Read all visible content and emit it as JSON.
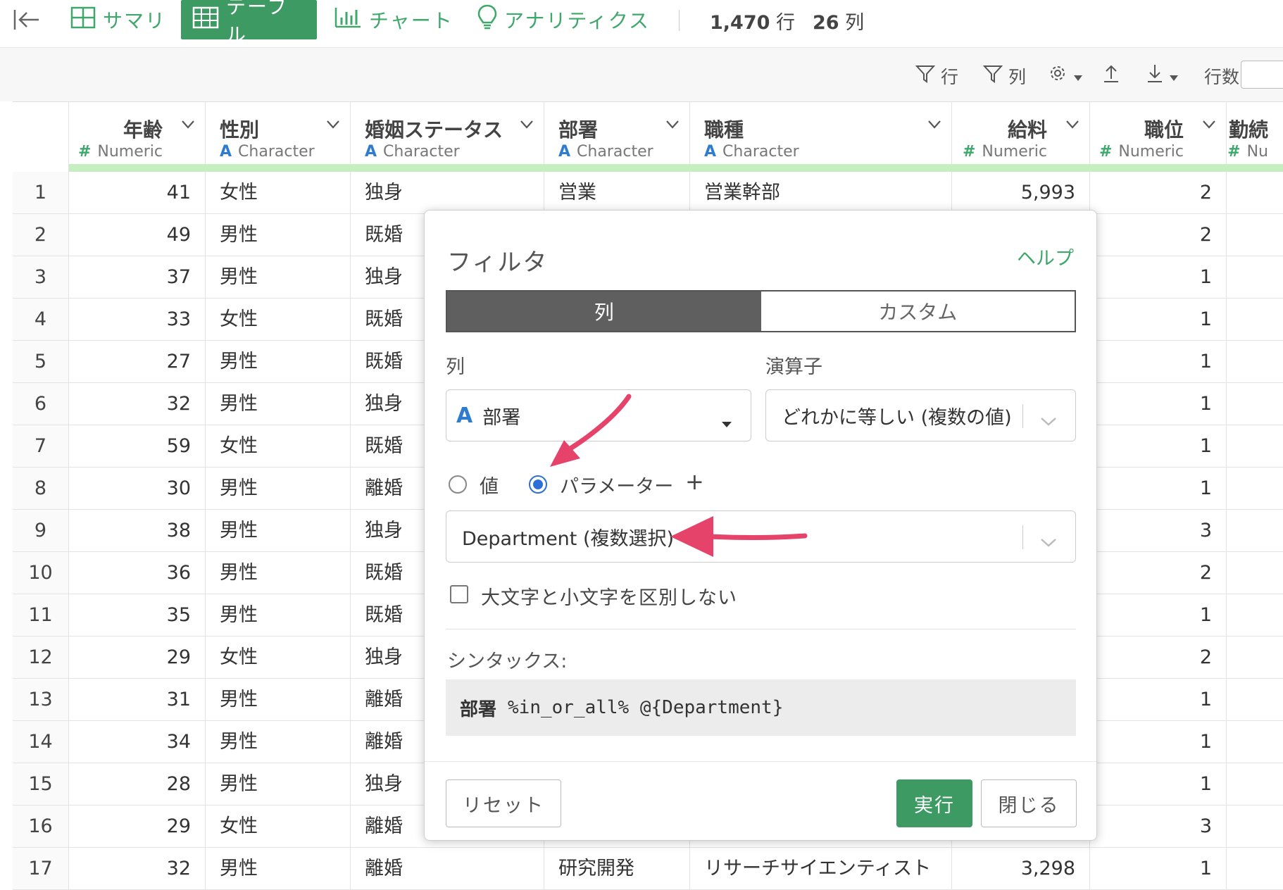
{
  "header": {
    "tabs": [
      {
        "label": "サマリ",
        "icon": "table-outline-icon"
      },
      {
        "label": "テーブル",
        "icon": "table-icon",
        "active": true
      },
      {
        "label": "チャート",
        "icon": "bar-chart-icon"
      },
      {
        "label": "アナリティクス",
        "icon": "lightbulb-icon"
      }
    ],
    "rows_count": "1,470",
    "rows_unit": "行",
    "cols_count": "26",
    "cols_unit": "列"
  },
  "toolbar": {
    "filter_rows": "行",
    "filter_cols": "列",
    "rows_per_page_label": "行数"
  },
  "columns": [
    {
      "name": "年齢",
      "type": "Numeric",
      "type_mark": "#"
    },
    {
      "name": "性別",
      "type": "Character",
      "type_mark": "A"
    },
    {
      "name": "婚姻ステータス",
      "type": "Character",
      "type_mark": "A"
    },
    {
      "name": "部署",
      "type": "Character",
      "type_mark": "A"
    },
    {
      "name": "職種",
      "type": "Character",
      "type_mark": "A"
    },
    {
      "name": "給料",
      "type": "Numeric",
      "type_mark": "#"
    },
    {
      "name": "職位",
      "type": "Numeric",
      "type_mark": "#"
    },
    {
      "name": "勤続",
      "type": "Nu",
      "type_mark": "#"
    }
  ],
  "rows": [
    {
      "n": "1",
      "age": "41",
      "sex": "女性",
      "mar": "独身",
      "dept": "営業",
      "job": "営業幹部",
      "sal": "5,993",
      "lvl": "2"
    },
    {
      "n": "2",
      "age": "49",
      "sex": "男性",
      "mar": "既婚",
      "dept": "",
      "job": "",
      "sal": "",
      "lvl": "2"
    },
    {
      "n": "3",
      "age": "37",
      "sex": "男性",
      "mar": "独身",
      "dept": "",
      "job": "",
      "sal": "",
      "lvl": "1"
    },
    {
      "n": "4",
      "age": "33",
      "sex": "女性",
      "mar": "既婚",
      "dept": "",
      "job": "",
      "sal": "",
      "lvl": "1"
    },
    {
      "n": "5",
      "age": "27",
      "sex": "男性",
      "mar": "既婚",
      "dept": "",
      "job": "",
      "sal": "",
      "lvl": "1"
    },
    {
      "n": "6",
      "age": "32",
      "sex": "男性",
      "mar": "独身",
      "dept": "",
      "job": "",
      "sal": "",
      "lvl": "1"
    },
    {
      "n": "7",
      "age": "59",
      "sex": "女性",
      "mar": "既婚",
      "dept": "",
      "job": "",
      "sal": "",
      "lvl": "1"
    },
    {
      "n": "8",
      "age": "30",
      "sex": "男性",
      "mar": "離婚",
      "dept": "",
      "job": "",
      "sal": "",
      "lvl": "1"
    },
    {
      "n": "9",
      "age": "38",
      "sex": "男性",
      "mar": "独身",
      "dept": "",
      "job": "",
      "sal": "",
      "lvl": "3"
    },
    {
      "n": "10",
      "age": "36",
      "sex": "男性",
      "mar": "既婚",
      "dept": "",
      "job": "",
      "sal": "",
      "lvl": "2"
    },
    {
      "n": "11",
      "age": "35",
      "sex": "男性",
      "mar": "既婚",
      "dept": "",
      "job": "",
      "sal": "",
      "lvl": "1"
    },
    {
      "n": "12",
      "age": "29",
      "sex": "女性",
      "mar": "独身",
      "dept": "",
      "job": "",
      "sal": "",
      "lvl": "2"
    },
    {
      "n": "13",
      "age": "31",
      "sex": "男性",
      "mar": "離婚",
      "dept": "",
      "job": "",
      "sal": "",
      "lvl": "1"
    },
    {
      "n": "14",
      "age": "34",
      "sex": "男性",
      "mar": "離婚",
      "dept": "",
      "job": "",
      "sal": "",
      "lvl": "1"
    },
    {
      "n": "15",
      "age": "28",
      "sex": "男性",
      "mar": "独身",
      "dept": "",
      "job": "",
      "sal": "",
      "lvl": "1"
    },
    {
      "n": "16",
      "age": "29",
      "sex": "女性",
      "mar": "離婚",
      "dept": "",
      "job": "",
      "sal": "",
      "lvl": "3"
    },
    {
      "n": "17",
      "age": "32",
      "sex": "男性",
      "mar": "離婚",
      "dept": "研究開発",
      "job": "リサーチサイエンティスト",
      "sal": "3,298",
      "lvl": "1"
    }
  ],
  "filter_modal": {
    "title": "フィルタ",
    "help": "ヘルプ",
    "tab_column": "列",
    "tab_custom": "カスタム",
    "column_label": "列",
    "operator_label": "演算子",
    "column_value": "部署",
    "column_type_mark": "A",
    "operator_value": "どれかに等しい (複数の値)",
    "radio_value": "値",
    "radio_parameter": "パラメーター",
    "add": "+",
    "parameter_value": "Department (複数選択)",
    "ignore_case": "大文字と小文字を区別しない",
    "syntax_label": "シンタックス:",
    "syntax_column": "部署",
    "syntax_expr": "%in_or_all% @{Department}",
    "reset": "リセット",
    "run": "実行",
    "close": "閉じる"
  },
  "colors": {
    "accent": "#3d9a63",
    "annotation_arrow": "#e5436a",
    "radio_selected": "#2d6fd8",
    "type_character": "#2e7bd0",
    "type_numeric": "#3ea86a"
  }
}
